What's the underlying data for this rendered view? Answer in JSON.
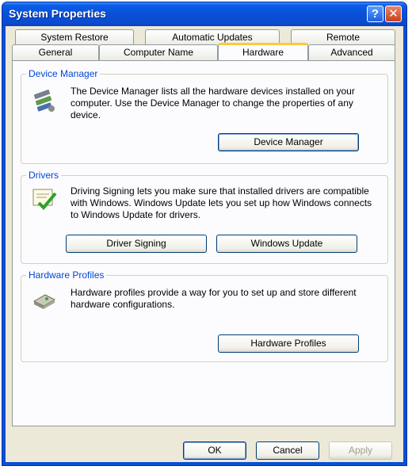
{
  "window": {
    "title": "System Properties"
  },
  "tabs": {
    "back_row": [
      "System Restore",
      "Automatic Updates",
      "Remote"
    ],
    "front_row": [
      "General",
      "Computer Name",
      "Hardware",
      "Advanced"
    ],
    "active": "Hardware"
  },
  "device_manager": {
    "title": "Device Manager",
    "text": "The Device Manager lists all the hardware devices installed on your computer. Use the Device Manager to change the properties of any device.",
    "button": "Device Manager",
    "icon": "device-manager-icon"
  },
  "drivers": {
    "title": "Drivers",
    "text": "Driving Signing lets you make sure that installed drivers are compatible with Windows. Windows Update lets you set up how Windows connects to Windows Update for drivers.",
    "signing_button": "Driver Signing",
    "update_button": "Windows Update",
    "icon": "driver-signing-icon"
  },
  "hardware_profiles": {
    "title": "Hardware Profiles",
    "text": "Hardware profiles provide a way for you to set up and store different hardware configurations.",
    "button": "Hardware Profiles",
    "icon": "hardware-profiles-icon"
  },
  "footer": {
    "ok": "OK",
    "cancel": "Cancel",
    "apply": "Apply"
  },
  "colors": {
    "titlebar": "#0a4fd6",
    "group_title": "#0046d5",
    "tab_highlight": "#ffc83c",
    "dialog_bg": "#ece9d8"
  }
}
